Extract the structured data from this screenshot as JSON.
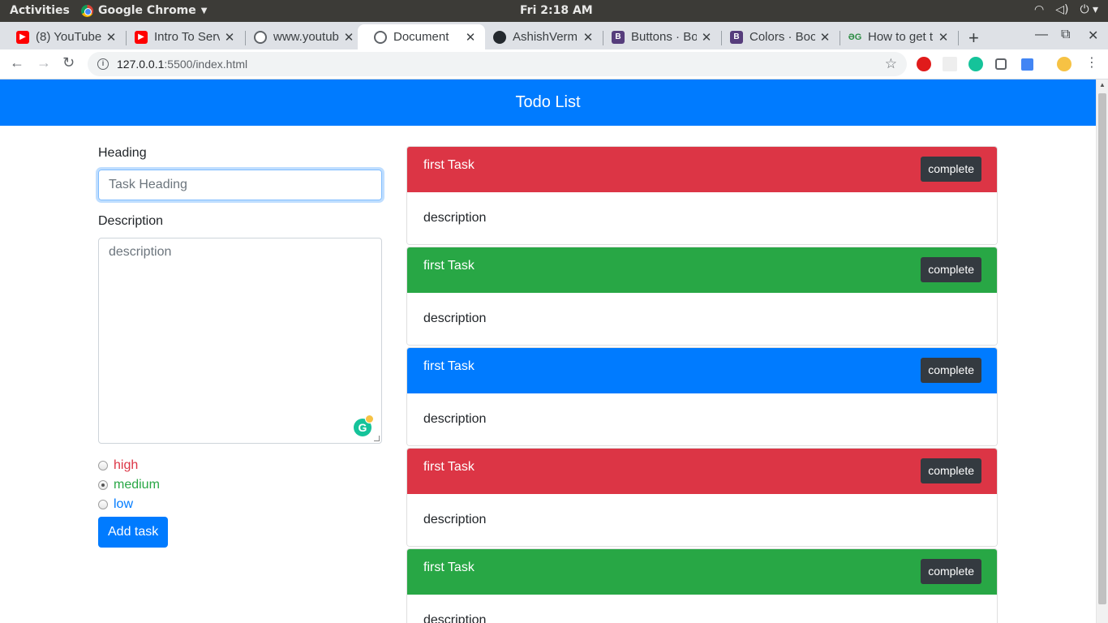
{
  "os": {
    "activities": "Activities",
    "app_name": "Google Chrome",
    "clock": "Fri  2:18 AM",
    "tray": [
      "wifi-icon",
      "volume-icon",
      "power-icon"
    ]
  },
  "tabs": [
    {
      "title": "(8) YouTube",
      "favicon": "youtube-icon",
      "active": false
    },
    {
      "title": "Intro To Serv",
      "favicon": "youtube-icon",
      "active": false
    },
    {
      "title": "www.youtub",
      "favicon": "globe-icon",
      "active": false
    },
    {
      "title": "Document",
      "favicon": "globe-icon",
      "active": true
    },
    {
      "title": "AshishVerm",
      "favicon": "github-icon",
      "active": false
    },
    {
      "title": "Buttons · Bo",
      "favicon": "bootstrap-icon",
      "active": false
    },
    {
      "title": "Colors · Boo",
      "favicon": "bootstrap-icon",
      "active": false
    },
    {
      "title": "How to get t",
      "favicon": "gfg-icon",
      "active": false
    }
  ],
  "toolbar": {
    "url_host": "127.0.0.1",
    "url_path": ":5500/index.html"
  },
  "app": {
    "title": "Todo List",
    "form": {
      "heading_label": "Heading",
      "heading_placeholder": "Task Heading",
      "heading_value": "",
      "description_label": "Description",
      "description_placeholder": "description",
      "priorities": [
        {
          "label": "high",
          "color": "#dc3545",
          "checked": false
        },
        {
          "label": "medium",
          "color": "#28a745",
          "checked": true
        },
        {
          "label": "low",
          "color": "#007bff",
          "checked": false
        }
      ],
      "submit_label": "Add task"
    },
    "tasks": [
      {
        "heading": "first Task",
        "description": "description",
        "color": "#dc3545",
        "button": "complete"
      },
      {
        "heading": "first Task",
        "description": "description",
        "color": "#28a745",
        "button": "complete"
      },
      {
        "heading": "first Task",
        "description": "description",
        "color": "#007bff",
        "button": "complete"
      },
      {
        "heading": "first Task",
        "description": "description",
        "color": "#dc3545",
        "button": "complete"
      },
      {
        "heading": "first Task",
        "description": "description",
        "color": "#28a745",
        "button": "complete"
      }
    ]
  },
  "colors": {
    "primary": "#007bff",
    "danger": "#dc3545",
    "success": "#28a745",
    "dark": "#343a40"
  }
}
